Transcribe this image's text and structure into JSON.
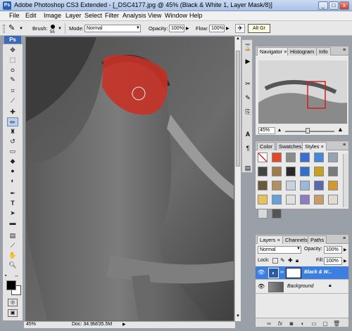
{
  "window": {
    "title": "Adobe Photoshop CS3 Extended - [_DSC4177.jpg @ 45% (Black & White 1, Layer Mask/8)]",
    "app_icon": "Ps",
    "minimize_glyph": "_",
    "maximize_glyph": "□",
    "close_glyph": "x"
  },
  "menu": [
    "File",
    "Edit",
    "Image",
    "Layer",
    "Select",
    "Filter",
    "Analysis",
    "View",
    "Window",
    "Help"
  ],
  "options": {
    "brush_label": "Brush:",
    "brush_size": "55",
    "mode_label": "Mode:",
    "mode_value": "Normal",
    "opacity_label": "Opacity:",
    "opacity_value": "100%",
    "flow_label": "Flow:",
    "flow_value": "100%",
    "tooltip": "Alt Gr"
  },
  "toolbox": {
    "ps_logo": "Ps"
  },
  "status": {
    "zoom": "45%",
    "doc": "Doc: 34.9M/35.5M"
  },
  "navigator": {
    "tabs": [
      "Navigator",
      "Histogram",
      "Info"
    ],
    "zoom": "45%",
    "zoom_level": 0.45
  },
  "styles_panel": {
    "tabs": [
      "Color",
      "Swatches",
      "Styles"
    ],
    "swatch_colors": [
      "#ffffff",
      "#e04a2a",
      "#8a8a8a",
      "#3a6fd0",
      "#4a86d8",
      "#9aa4b0",
      "#444444",
      "#a07a48",
      "#2a2a2a",
      "#3070c8",
      "#c8a020",
      "#7a7a7a",
      "#6a5a3a",
      "#b09060",
      "#c7d2de",
      "#9ab8d8",
      "#5a6ab0",
      "#d09a30",
      "#e7c15a",
      "#6aa0d8",
      "#e0e0e0",
      "#8c7cc0",
      "#c69c68",
      "#e0dcd0",
      "#d8d8d8",
      "#555555"
    ]
  },
  "layers": {
    "tabs": [
      "Layers",
      "Channels",
      "Paths"
    ],
    "blend_mode": "Normal",
    "opacity_label": "Opacity:",
    "opacity_value": "100%",
    "lock_label": "Lock:",
    "fill_label": "Fill:",
    "fill_value": "100%",
    "items": [
      {
        "name": "Black & W...",
        "selected": true
      },
      {
        "name": "Background",
        "selected": false
      }
    ],
    "bottom_icons": [
      "link-icon",
      "fx-icon",
      "mask-icon",
      "adjustment-icon",
      "folder-icon",
      "new-layer-icon",
      "trash-icon"
    ]
  }
}
